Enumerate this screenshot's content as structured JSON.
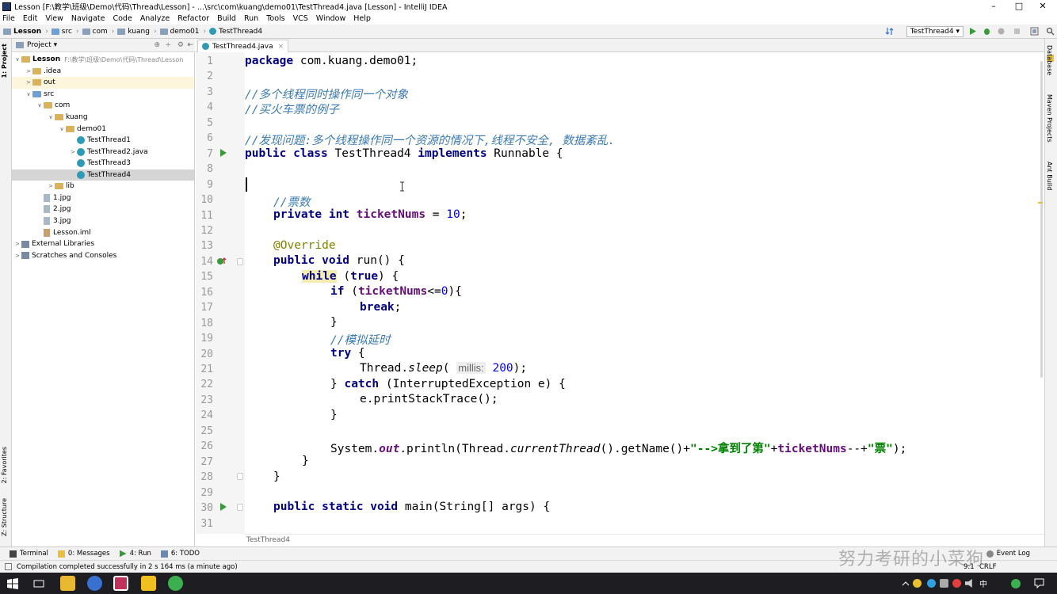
{
  "window": {
    "title": "Lesson [F:\\教学\\班级\\Demo\\代码\\Thread\\Lesson] - ...\\src\\com\\kuang\\demo01\\TestThread4.java [Lesson] - IntelliJ IDEA",
    "minimize": "–",
    "maximize": "□",
    "close": "✕"
  },
  "menu": [
    "File",
    "Edit",
    "View",
    "Navigate",
    "Code",
    "Analyze",
    "Refactor",
    "Build",
    "Run",
    "Tools",
    "VCS",
    "Window",
    "Help"
  ],
  "breadcrumb": [
    "Lesson",
    "src",
    "com",
    "kuang",
    "demo01",
    "TestThread4"
  ],
  "toolbar": {
    "run_config": "TestThread4 ▾"
  },
  "left_tool_tabs": {
    "project": "1: Project",
    "favorites": "2: Favorites",
    "structure": "Z: Structure"
  },
  "project_panel": {
    "header": "Project ▾",
    "tree": [
      {
        "label": "Lesson",
        "extra": "F:\\教学\\班级\\Demo\\代码\\Thread\\Lesson",
        "icon": "folder",
        "arrow": "∨",
        "depth": 0
      },
      {
        "label": ".idea",
        "icon": "folder",
        "arrow": ">",
        "depth": 1
      },
      {
        "label": "out",
        "icon": "folder",
        "arrow": ">",
        "depth": 1,
        "highlight": "out"
      },
      {
        "label": "src",
        "icon": "src-folder",
        "arrow": "∨",
        "depth": 1
      },
      {
        "label": "com",
        "icon": "folder",
        "arrow": "∨",
        "depth": 2
      },
      {
        "label": "kuang",
        "icon": "folder",
        "arrow": "∨",
        "depth": 3
      },
      {
        "label": "demo01",
        "icon": "folder",
        "arrow": "∨",
        "depth": 4
      },
      {
        "label": "TestThread1",
        "icon": "java",
        "arrow": "",
        "depth": 5
      },
      {
        "label": "TestThread2.java",
        "icon": "java",
        "arrow": ">",
        "depth": 5
      },
      {
        "label": "TestThread3",
        "icon": "java",
        "arrow": "",
        "depth": 5
      },
      {
        "label": "TestThread4",
        "icon": "java",
        "arrow": "",
        "depth": 5,
        "highlight": "selected"
      },
      {
        "label": "lib",
        "icon": "folder",
        "arrow": ">",
        "depth": 3
      },
      {
        "label": "1.jpg",
        "icon": "image",
        "arrow": "",
        "depth": 2
      },
      {
        "label": "2.jpg",
        "icon": "image",
        "arrow": "",
        "depth": 2
      },
      {
        "label": "3.jpg",
        "icon": "image",
        "arrow": "",
        "depth": 2
      },
      {
        "label": "Lesson.iml",
        "icon": "xml",
        "arrow": "",
        "depth": 2
      },
      {
        "label": "External Libraries",
        "icon": "library",
        "arrow": ">",
        "depth": 0
      },
      {
        "label": "Scratches and Consoles",
        "icon": "library",
        "arrow": ">",
        "depth": 0
      }
    ]
  },
  "editor": {
    "tab": "TestThread4.java",
    "tab_close": "×",
    "footer_crumb": "TestThread4",
    "line_numbers": [
      "1",
      "2",
      "3",
      "4",
      "5",
      "6",
      "7",
      "8",
      "9",
      "10",
      "11",
      "12",
      "13",
      "14",
      "15",
      "16",
      "17",
      "18",
      "19",
      "20",
      "21",
      "22",
      "23",
      "24",
      "25",
      "26",
      "27",
      "28",
      "29",
      "30",
      "31"
    ],
    "code": {
      "l1_kw": "package",
      "l1_rest": " com.kuang.demo01;",
      "l3": "//多个线程同时操作同一个对象",
      "l4": "//买火车票的例子",
      "l6": "//发现问题:多个线程操作同一个资源的情况下,线程不安全, 数据紊乱.",
      "l7_kw1": "public class",
      "l7_mid": " TestThread4 ",
      "l7_kw2": "implements",
      "l7_rest": " Runnable {",
      "l10": "//票数",
      "l11_kw": "private int",
      "l11_sp": " ",
      "l11_fld": "ticketNums",
      "l11_eq": " = ",
      "l11_num": "10",
      "l11_end": ";",
      "l13": "@Override",
      "l14_kw": "public void",
      "l14_rest": " run() {",
      "l15_kw": "while",
      "l15_sp": " (",
      "l15_kw2": "true",
      "l15_rest": ") {",
      "l16_kw": "if",
      "l16_p": " (",
      "l16_fld": "ticketNums",
      "l16_op": "<=",
      "l16_num": "0",
      "l16_end": "){",
      "l17_kw": "break",
      "l17_end": ";",
      "l18": "}",
      "l19": "//模拟延时",
      "l20_kw": "try",
      "l20_end": " {",
      "l21_a": "Thread.",
      "l21_it": "sleep",
      "l21_p": "( ",
      "l21_hint": "millis:",
      "l21_num": " 200",
      "l21_end": ");",
      "l22_a": "} ",
      "l22_kw": "catch",
      "l22_rest": " (InterruptedException e) {",
      "l23": "e.printStackTrace();",
      "l24": "}",
      "l26_a": "System.",
      "l26_out": "out",
      "l26_b": ".println(Thread.",
      "l26_it": "currentThread",
      "l26_c": "().getName()+",
      "l26_s1": "\"-->拿到了第\"",
      "l26_d": "+",
      "l26_fld": "ticketNums",
      "l26_e": "--+",
      "l26_s2": "\"票\"",
      "l26_f": ");",
      "l27": "}",
      "l28": "}",
      "l30_kw": "public static void",
      "l30_rest": " main(String[] args) {"
    }
  },
  "right_tool_tabs": {
    "database": "Database",
    "maven": "Maven Projects",
    "ant": "Ant Build"
  },
  "bottom_tabs": [
    "Terminal",
    "0: Messages",
    "4: Run",
    "6: TODO"
  ],
  "event_log": "Event Log",
  "status": {
    "message": "Compilation completed successfully in 2 s 164 ms (a minute ago)",
    "position": "9:1",
    "line_sep": "CRLF"
  },
  "watermark": "努力考研的小菜狗",
  "taskbar": {
    "lang": "中",
    "clock": ""
  }
}
